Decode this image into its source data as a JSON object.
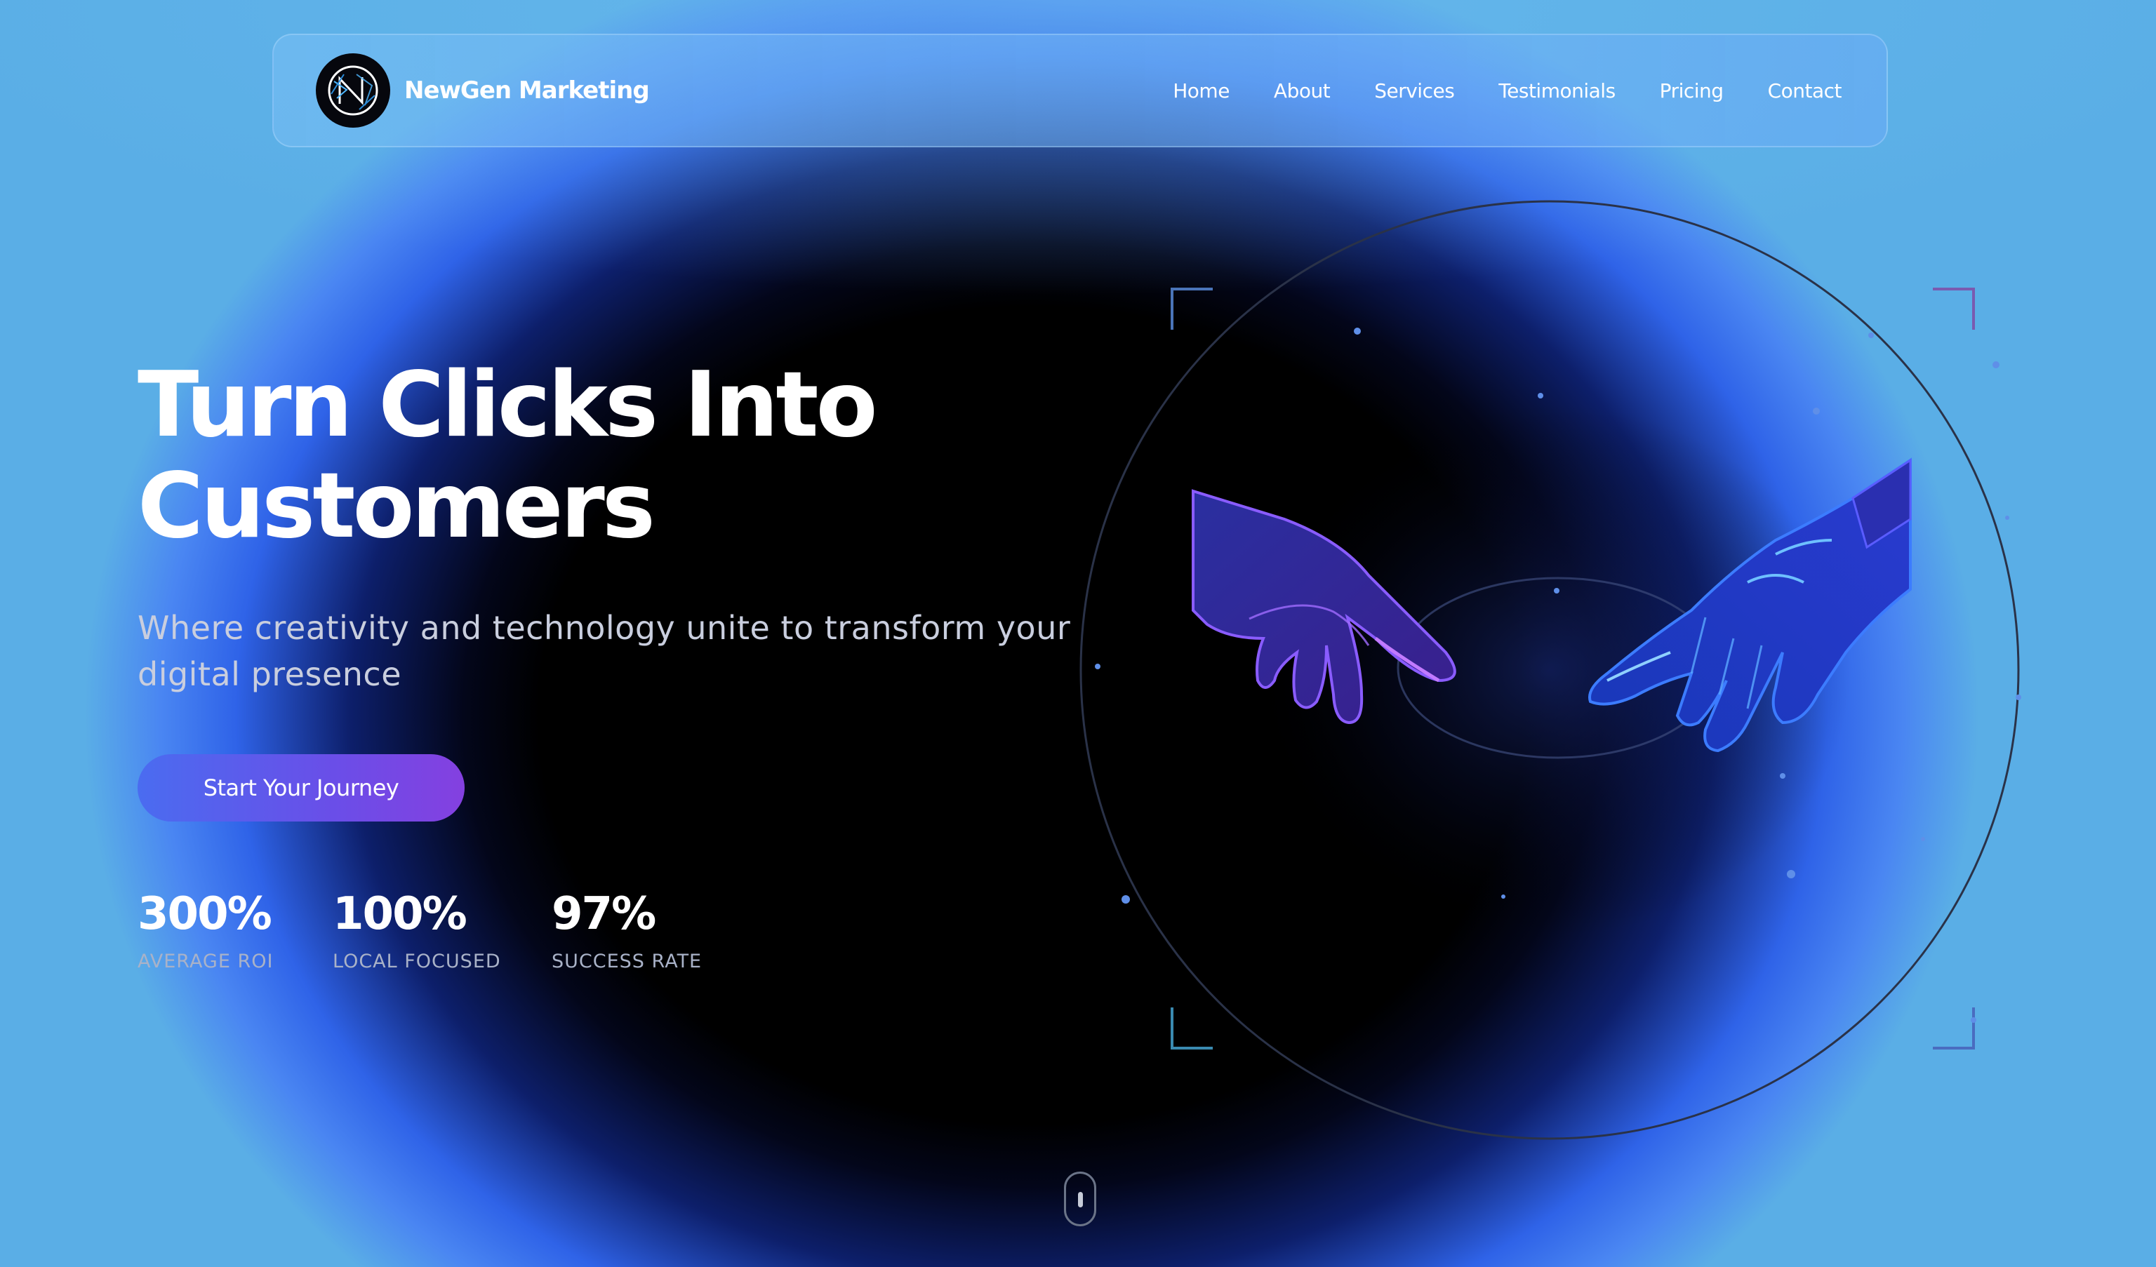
{
  "brand": {
    "name": "NewGen Marketing",
    "logo_icon": "ng-monogram-logo"
  },
  "nav": {
    "items": [
      {
        "label": "Home"
      },
      {
        "label": "About"
      },
      {
        "label": "Services"
      },
      {
        "label": "Testimonials"
      },
      {
        "label": "Pricing"
      },
      {
        "label": "Contact"
      }
    ]
  },
  "hero": {
    "title_line1": "Turn Clicks Into",
    "title_line2": "Customers",
    "subtitle": "Where creativity and technology unite to transform your digital presence",
    "cta_label": "Start Your Journey"
  },
  "stats": [
    {
      "value": "300%",
      "label": "AVERAGE ROI"
    },
    {
      "value": "100%",
      "label": "LOCAL FOCUSED"
    },
    {
      "value": "97%",
      "label": "SUCCESS RATE"
    }
  ],
  "illustration": {
    "icon": "human-and-robot-hands-icon"
  },
  "scroll_indicator": {
    "icon": "mouse-scroll-icon"
  },
  "colors": {
    "accent_start": "#4a6cf0",
    "accent_end": "#8440e0",
    "background_glow": "#3f7cf0",
    "background_core": "#000000"
  }
}
